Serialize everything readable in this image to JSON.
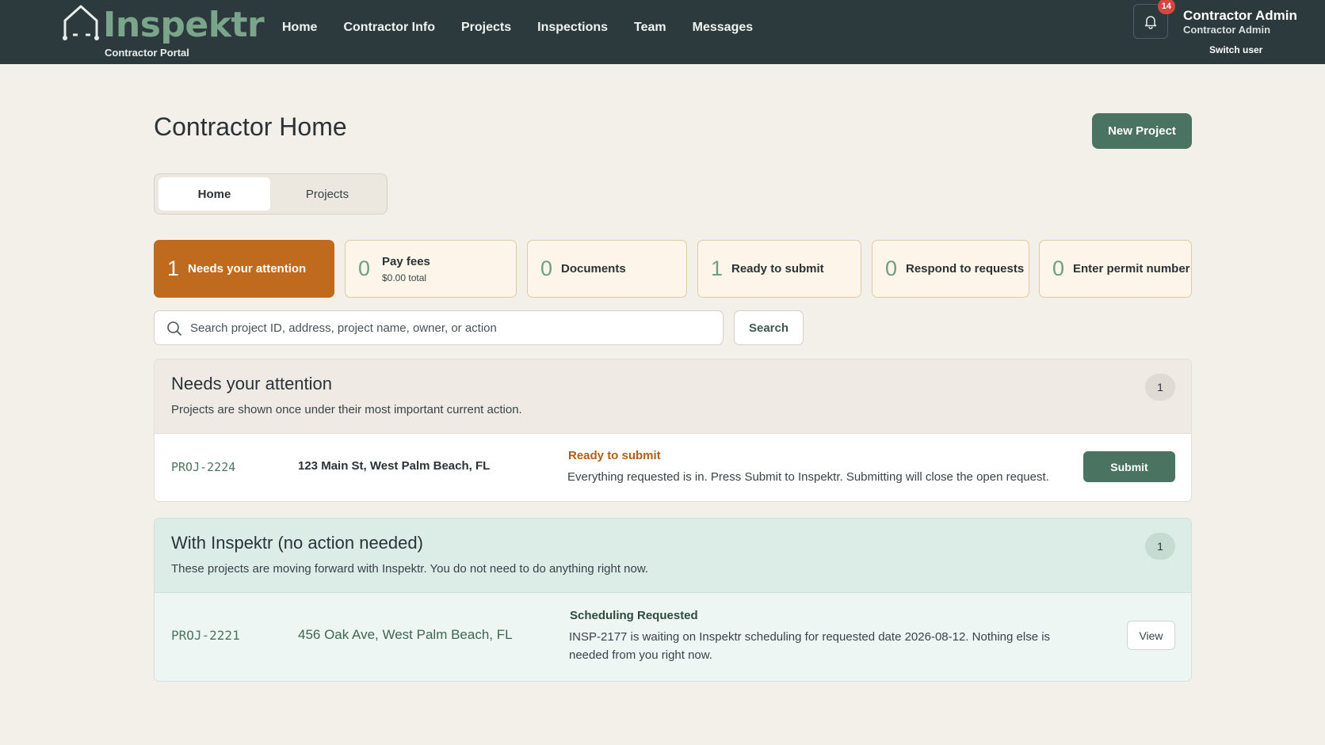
{
  "brand": {
    "name": "Inspektr",
    "subtitle": "Contractor Portal"
  },
  "nav": [
    "Home",
    "Contractor Info",
    "Projects",
    "Inspections",
    "Team",
    "Messages"
  ],
  "notifications": {
    "count": "14"
  },
  "user": {
    "name": "Contractor Admin",
    "role": "Contractor Admin",
    "switch_label": "Switch user"
  },
  "page": {
    "title": "Contractor Home",
    "new_project_label": "New Project"
  },
  "tabs": [
    {
      "label": "Home",
      "active": true
    },
    {
      "label": "Projects",
      "active": false
    }
  ],
  "stats": [
    {
      "count": "1",
      "label": "Needs your attention",
      "active": true
    },
    {
      "count": "0",
      "label": "Pay fees",
      "sub": "$0.00 total"
    },
    {
      "count": "0",
      "label": "Documents"
    },
    {
      "count": "1",
      "label": "Ready to submit"
    },
    {
      "count": "0",
      "label": "Respond to requests"
    },
    {
      "count": "0",
      "label": "Enter permit number"
    }
  ],
  "search": {
    "placeholder": "Search project ID, address, project name, owner, or action",
    "button": "Search"
  },
  "sections": [
    {
      "title": "Needs your attention",
      "description": "Projects are shown once under their most important current action.",
      "count": "1",
      "rows": [
        {
          "id": "PROJ-2224",
          "address": "123 Main St, West Palm Beach, FL",
          "status": "Ready to submit",
          "note": "Everything requested is in. Press Submit to Inspektr. Submitting will close the open request.",
          "action": "Submit"
        }
      ]
    },
    {
      "title": "With Inspektr (no action needed)",
      "description": "These projects are moving forward with Inspektr. You do not need to do anything right now.",
      "count": "1",
      "rows": [
        {
          "id": "PROJ-2221",
          "address": "456 Oak Ave, West Palm Beach, FL",
          "status": "Scheduling Requested",
          "note": "INSP-2177 is waiting on Inspektr scheduling for requested date 2026-08-12. Nothing else is needed from you right now.",
          "action": "View"
        }
      ]
    }
  ],
  "colors": {
    "topbar": "#2c3a3d",
    "accent_green": "#4a7461",
    "attention_orange": "#c06a1e",
    "brand_green": "#7aa58a"
  }
}
